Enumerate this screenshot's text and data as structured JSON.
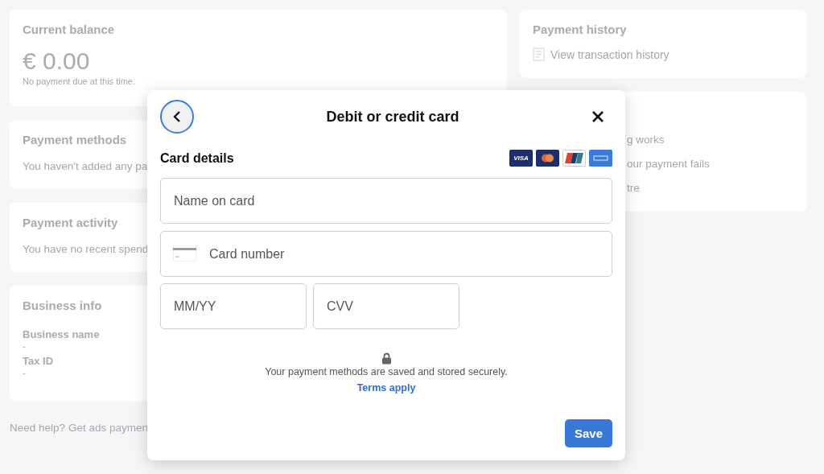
{
  "balance_card": {
    "title": "Current balance",
    "amount": "€ 0.00",
    "note": "No payment due at this time."
  },
  "payment_methods_card": {
    "title": "Payment methods",
    "text": "You haven't added any pa"
  },
  "payment_activity_card": {
    "title": "Payment activity",
    "text": "You have no recent spend"
  },
  "business_info_card": {
    "title": "Business info",
    "fields": [
      {
        "label": "Business name",
        "value": "-"
      },
      {
        "label": "Tax ID",
        "value": "-"
      }
    ]
  },
  "help": {
    "text": "Need help?",
    "link": "Get ads paymen"
  },
  "payment_history_card": {
    "title": "Payment history",
    "link": "View transaction history"
  },
  "info_card": {
    "links": [
      "g works",
      "our payment fails",
      "tre"
    ]
  },
  "dialog": {
    "title": "Debit or credit card",
    "section": "Card details",
    "brands": [
      {
        "kind": "visa",
        "label": "VISA"
      },
      {
        "kind": "mastercard"
      },
      {
        "kind": "unionpay"
      },
      {
        "kind": "amex"
      }
    ],
    "fields": {
      "name": {
        "placeholder": "Name on card"
      },
      "number": {
        "placeholder": "Card number"
      },
      "expiry": {
        "placeholder": "MM/YY"
      },
      "cvv": {
        "placeholder": "CVV"
      }
    },
    "security_note": "Your payment methods are saved and stored securely.",
    "terms_link": "Terms apply",
    "save_button": "Save"
  }
}
